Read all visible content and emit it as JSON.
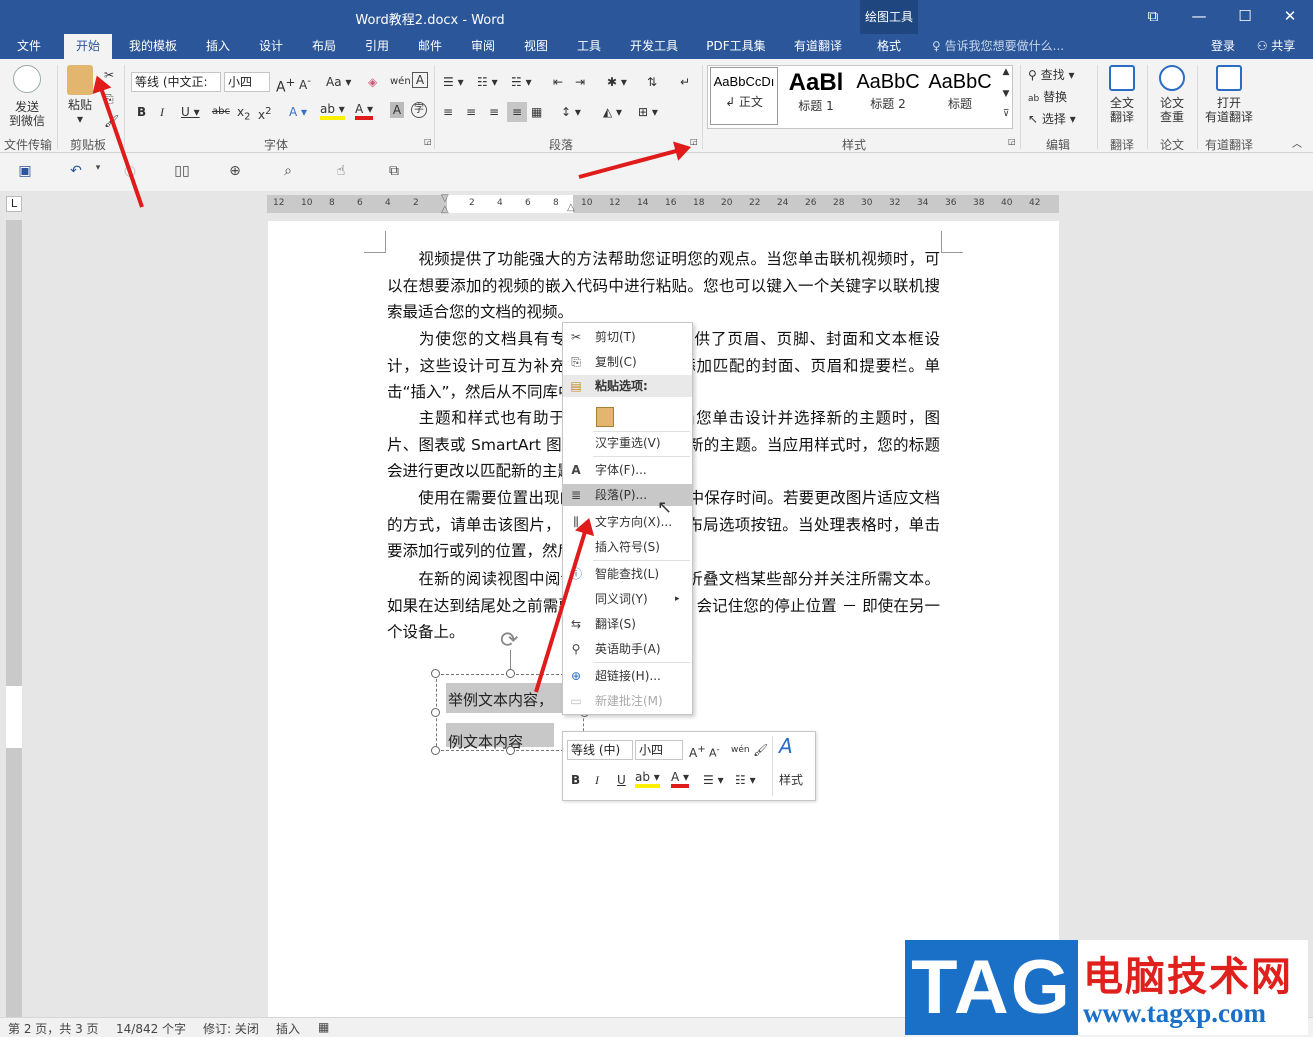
{
  "window": {
    "title": "Word教程2.docx - Word",
    "context_tab_group": "绘图工具",
    "controls": [
      "⧉",
      "—",
      "☐",
      "✕"
    ]
  },
  "tabs": [
    "文件",
    "开始",
    "我的模板",
    "插入",
    "设计",
    "布局",
    "引用",
    "邮件",
    "审阅",
    "视图",
    "工具",
    "开发工具",
    "PDF工具集",
    "有道翻译",
    "格式"
  ],
  "active_tab": "开始",
  "tell_me": "告诉我您想要做什么...",
  "sign_in": "登录",
  "share": "共享",
  "ribbon": {
    "send_to_wechat": "发送\n到微信",
    "file_transfer": "文件传输",
    "paste": "粘贴",
    "clipboard": "剪贴板",
    "font_name": "等线 (中文正:",
    "font_size": "小四",
    "font_group": "字体",
    "paragraph_group": "段落",
    "styles": [
      {
        "sample": "AaBbCcDı",
        "name": "↲ 正文"
      },
      {
        "sample": "AaBl",
        "name": "标题 1"
      },
      {
        "sample": "AaBbC",
        "name": "标题 2"
      },
      {
        "sample": "AaBbC",
        "name": "标题"
      }
    ],
    "styles_group": "样式",
    "find": "查找",
    "replace": "替换",
    "select": "选择",
    "edit_group": "编辑",
    "full_translate": "全文\n翻译",
    "translate_group": "翻译",
    "paper_check": "论文\n查重",
    "paper_group": "论文",
    "open_youdao": "打开\n有道翻译",
    "youdao_group": "有道翻译"
  },
  "document": {
    "paragraphs": [
      "视频提供了功能强大的方法帮助您证明您的观点。当您单击联机视频时，可以在想要添加的视频的嵌入代码中进行粘贴。您也可以键入一个关键字以联机搜索最适合您的文档的视频。",
      "为使您的文档具有专业外观，Word 提供了页眉、页脚、封面和文本框设计，这些设计可互为补充。例如，您可以添加匹配的封面、页眉和提要栏。单击“插入”，然后从不同库中选择所需元素。",
      "主题和样式也有助于文档保持协调。当您单击设计并选择新的主题时，图片、图表或 SmartArt 图形将会更改以匹配新的主题。当应用样式时，您的标题会进行更改以匹配新的主题。",
      "使用在需要位置出现的新按钮在 Word 中保存时间。若要更改图片适应文档的方式，请单击该图片，图片旁边将会显示布局选项按钮。当处理表格时，单击要添加行或列的位置，然后单击加号。",
      "在新的阅读视图中阅读更加容易。可以折叠文档某些部分并关注所需文本。如果在达到结尾处之前需要停止读取，Word 会记住您的停止位置 － 即使在另一个设备上。"
    ],
    "textbox_line1": "举例文本内容，",
    "textbox_line2": "例文本内容"
  },
  "context_menu": [
    {
      "icon": "scissors-icon",
      "label": "剪切(T)"
    },
    {
      "icon": "copy-icon",
      "label": "复制(C)"
    },
    {
      "icon": "paste-icon",
      "label": "粘贴选项:",
      "header": true
    },
    {
      "icon": "paste-option-icon",
      "label": ""
    },
    {
      "icon": "",
      "label": "汉字重选(V)"
    },
    {
      "icon": "font-icon",
      "label": "字体(F)..."
    },
    {
      "icon": "paragraph-icon",
      "label": "段落(P)...",
      "hover": true
    },
    {
      "icon": "text-direction-icon",
      "label": "文字方向(X)..."
    },
    {
      "icon": "",
      "label": "插入符号(S)"
    },
    {
      "icon": "smart-lookup-icon",
      "label": "智能查找(L)"
    },
    {
      "icon": "",
      "label": "同义词(Y)",
      "submenu": true
    },
    {
      "icon": "translate-icon",
      "label": "翻译(S)"
    },
    {
      "icon": "english-assistant-icon",
      "label": "英语助手(A)"
    },
    {
      "icon": "hyperlink-icon",
      "label": "超链接(H)..."
    },
    {
      "icon": "new-comment-icon",
      "label": "新建批注(M)",
      "disabled": true
    }
  ],
  "mini_toolbar": {
    "font_name": "等线 (中)",
    "font_size": "小四",
    "styles_label": "样式"
  },
  "status": {
    "page": "第 2 页，共 3 页",
    "words": "14/842 个字",
    "track": "修订: 关闭",
    "mode": "插入"
  },
  "ruler": {
    "h_ticks": [
      "12",
      "10",
      "8",
      "6",
      "4",
      "2",
      "",
      "2",
      "4",
      "6",
      "8",
      "10",
      "12",
      "14",
      "16",
      "18",
      "20",
      "22",
      "24",
      "26",
      "28",
      "30",
      "32",
      "34",
      "36",
      "38",
      "40",
      "42"
    ]
  },
  "watermark": {
    "tag": "TAG",
    "site_name": "电脑技术网",
    "url": "www.tagxp.com"
  },
  "colors": {
    "word_blue": "#2b579a",
    "annotation_red": "#e01b1b",
    "watermark_blue": "#1a6fc7",
    "watermark_red": "#e0201c"
  }
}
